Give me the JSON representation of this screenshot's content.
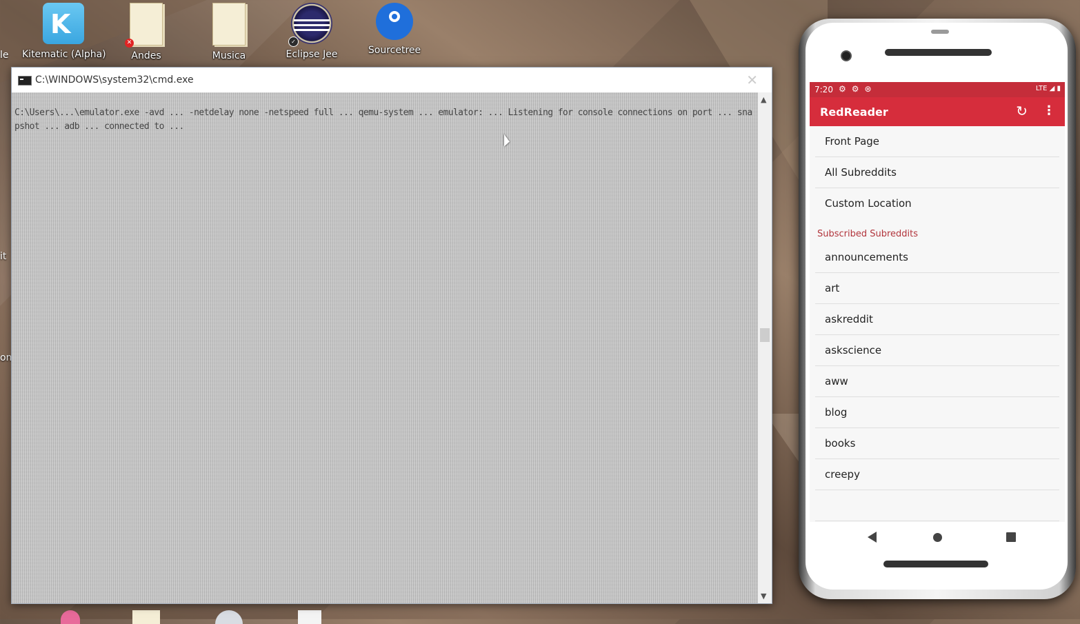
{
  "desktop": {
    "icons": [
      {
        "label": "Kitematic (Alpha)",
        "icon": "kitematic-icon"
      },
      {
        "label": "Andes",
        "icon": "folder-icon"
      },
      {
        "label": "Musica",
        "icon": "folder-icon"
      },
      {
        "label": "Eclipse Jee",
        "icon": "eclipse-icon"
      },
      {
        "label": "Sourcetree",
        "icon": "sourcetree-icon"
      }
    ],
    "edge_labels": [
      "le",
      "it",
      "om"
    ]
  },
  "cmd": {
    "title": "C:\\WINDOWS\\system32\\cmd.exe",
    "close_label": "✕",
    "output": "C:\\Users\\...\\emulator.exe -avd ... -netdelay none -netspeed full ... qemu-system ... emulator: ... Listening for console connections on port ... snapshot ... adb ... connected to ...",
    "scroll_up": "▲",
    "scroll_down": "▼"
  },
  "phone": {
    "status": {
      "time": "7:20",
      "icons": "⚙⚙⊛",
      "right": "LTE ◢ ▮"
    },
    "appbar": {
      "title": "RedReader",
      "refresh_icon": "↻",
      "more_icon": "⋮"
    },
    "main_items": [
      "Front Page",
      "All Subreddits",
      "Custom Location"
    ],
    "section_header": "Subscribed Subreddits",
    "subreddits": [
      "announcements",
      "art",
      "askreddit",
      "askscience",
      "aww",
      "blog",
      "books",
      "creepy"
    ]
  },
  "colors": {
    "app_red": "#d62d3c",
    "status_red": "#c52d3a",
    "section_red": "#b2353c"
  }
}
